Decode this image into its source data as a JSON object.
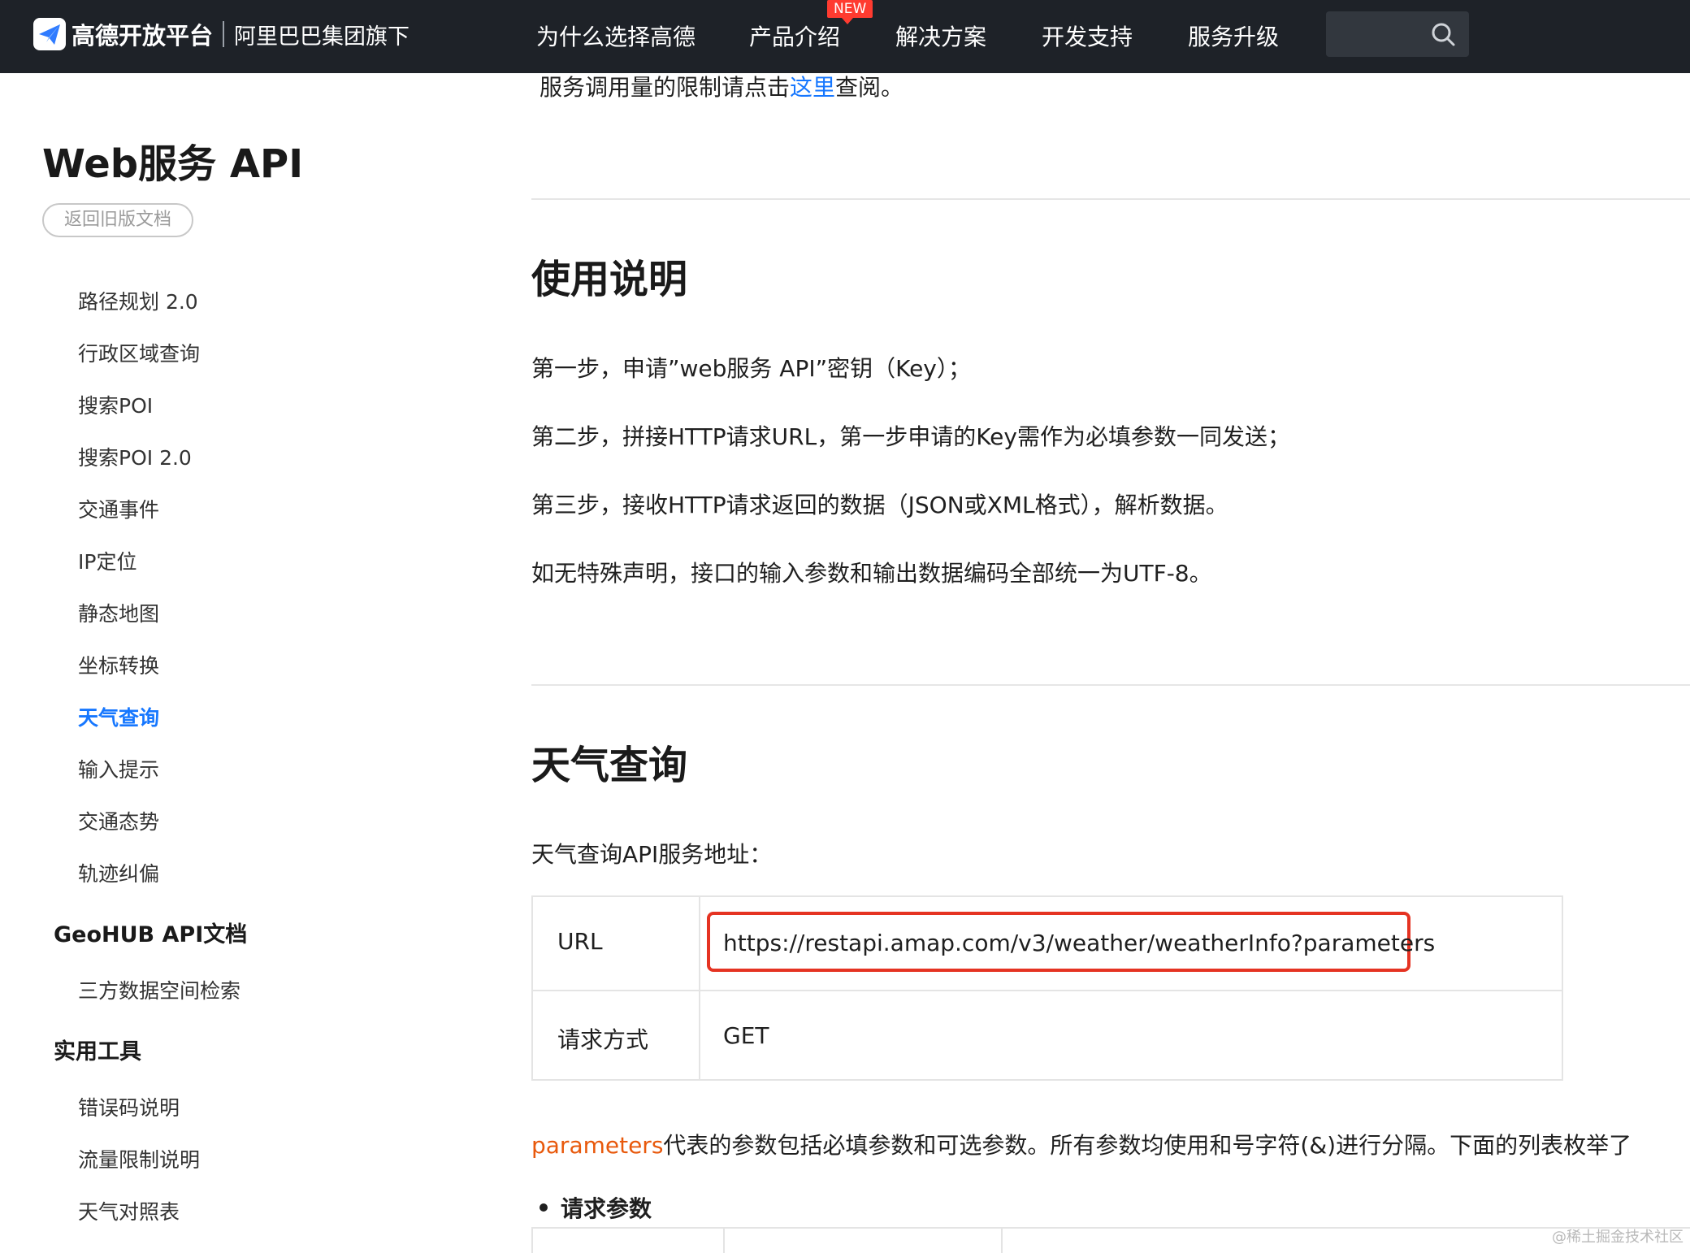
{
  "header": {
    "logo_text": "高德开放平台",
    "logo_sub": "阿里巴巴集团旗下",
    "nav": [
      "为什么选择高德",
      "产品介绍",
      "解决方案",
      "开发支持",
      "服务升级"
    ],
    "new_badge": "NEW",
    "logo_color": "#2f7bff",
    "bg_color": "#1e2228"
  },
  "sidebar": {
    "title": "Web服务 API",
    "old_docs_button": "返回旧版文档",
    "items": [
      "路径规划 2.0",
      "行政区域查询",
      "搜索POI",
      "搜索POI 2.0",
      "交通事件",
      "IP定位",
      "静态地图",
      "坐标转换",
      "天气查询",
      "输入提示",
      "交通态势",
      "轨迹纠偏"
    ],
    "active_item": "天气查询",
    "groups": [
      {
        "title": "GeoHUB API文档",
        "items": [
          "三方数据空间检索"
        ]
      },
      {
        "title": "实用工具",
        "items": [
          "错误码说明",
          "流量限制说明",
          "天气对照表"
        ]
      }
    ],
    "accent_color": "#1677ff"
  },
  "main": {
    "top_note_before": "服务调用量的限制请点击",
    "top_note_link": "这里",
    "top_note_after": "查阅。",
    "usage": {
      "heading": "使用说明",
      "steps": [
        "第一步，申请”web服务 API”密钥（Key）；",
        "第二步，拼接HTTP请求URL，第一步申请的Key需作为必填参数一同发送；",
        "第三步，接收HTTP请求返回的数据（JSON或XML格式），解析数据。",
        "如无特殊声明，接口的输入参数和输出数据编码全部统一为UTF-8。"
      ]
    },
    "weather": {
      "heading": "天气查询",
      "intro": "天气查询API服务地址：",
      "table": {
        "url_label": "URL",
        "url_value": "https://restapi.amap.com/v3/weather/weatherInfo?parameters",
        "method_label": "请求方式",
        "method_value": "GET"
      },
      "highlight_color": "#e53322",
      "params_word": "parameters",
      "params_text": "代表的参数包括必填参数和可选参数。所有参数均使用和号字符(&)进行分隔。下面的列表枚举了",
      "params_word_color": "#e8590c",
      "request_params": "请求参数"
    }
  },
  "watermark": "@稀土掘金技术社区"
}
